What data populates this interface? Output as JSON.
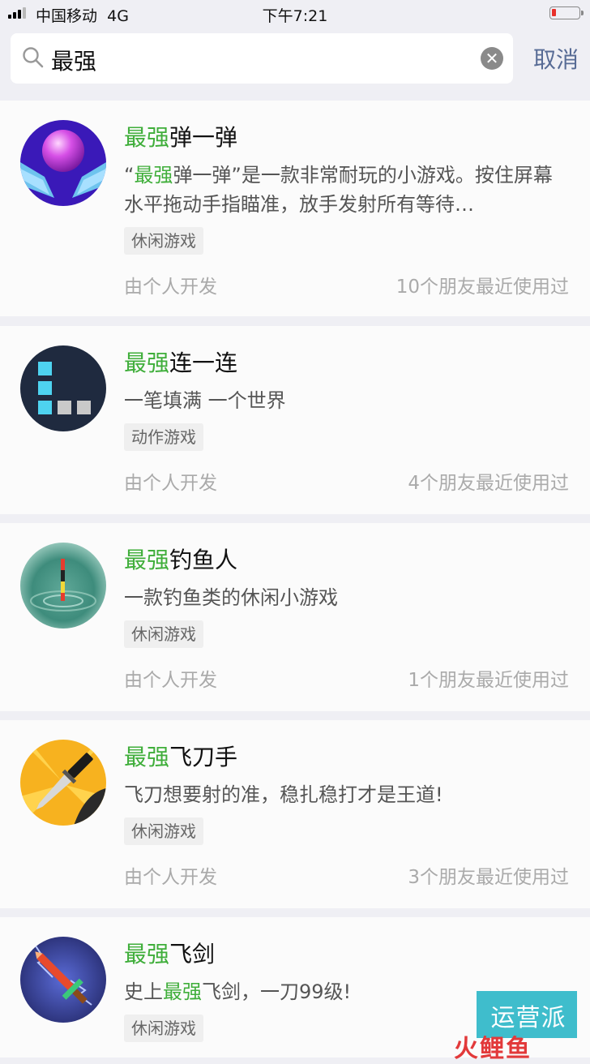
{
  "status_bar": {
    "carrier": "中国移动",
    "network": "4G",
    "time": "下午7:21"
  },
  "search": {
    "query": "最强",
    "clear_symbol": "✕",
    "cancel_label": "取消"
  },
  "results": [
    {
      "title_highlight": "最强",
      "title_rest": "弹一弹",
      "desc_q_open": "“",
      "desc_highlight": "最强",
      "desc_rest": "弹一弹”是一款非常耐玩的小游戏。按住屏幕水平拖动手指瞄准，放手发射所有等待…",
      "tag": "休闲游戏",
      "developer": "由个人开发",
      "friends": "10个朋友最近使用过"
    },
    {
      "title_highlight": "最强",
      "title_rest": "连一连",
      "desc": "一笔填满 一个世界",
      "tag": "动作游戏",
      "developer": "由个人开发",
      "friends": "4个朋友最近使用过"
    },
    {
      "title_highlight": "最强",
      "title_rest": "钓鱼人",
      "desc": "一款钓鱼类的休闲小游戏",
      "tag": "休闲游戏",
      "developer": "由个人开发",
      "friends": "1个朋友最近使用过"
    },
    {
      "title_highlight": "最强",
      "title_rest": "飞刀手",
      "desc": "飞刀想要射的准，稳扎稳打才是王道!",
      "tag": "休闲游戏",
      "developer": "由个人开发",
      "friends": "3个朋友最近使用过"
    },
    {
      "title_highlight": "最强",
      "title_rest": "飞剑",
      "desc_pre": "史上",
      "desc_highlight": "最强",
      "desc_rest": "飞剑，一刀99级!",
      "tag": "休闲游戏"
    }
  ],
  "watermark": {
    "line1": "运营派",
    "line2": "火鲤鱼"
  },
  "colors": {
    "highlight": "#3fae3a",
    "cancel": "#576b95",
    "background": "#efeff4"
  }
}
